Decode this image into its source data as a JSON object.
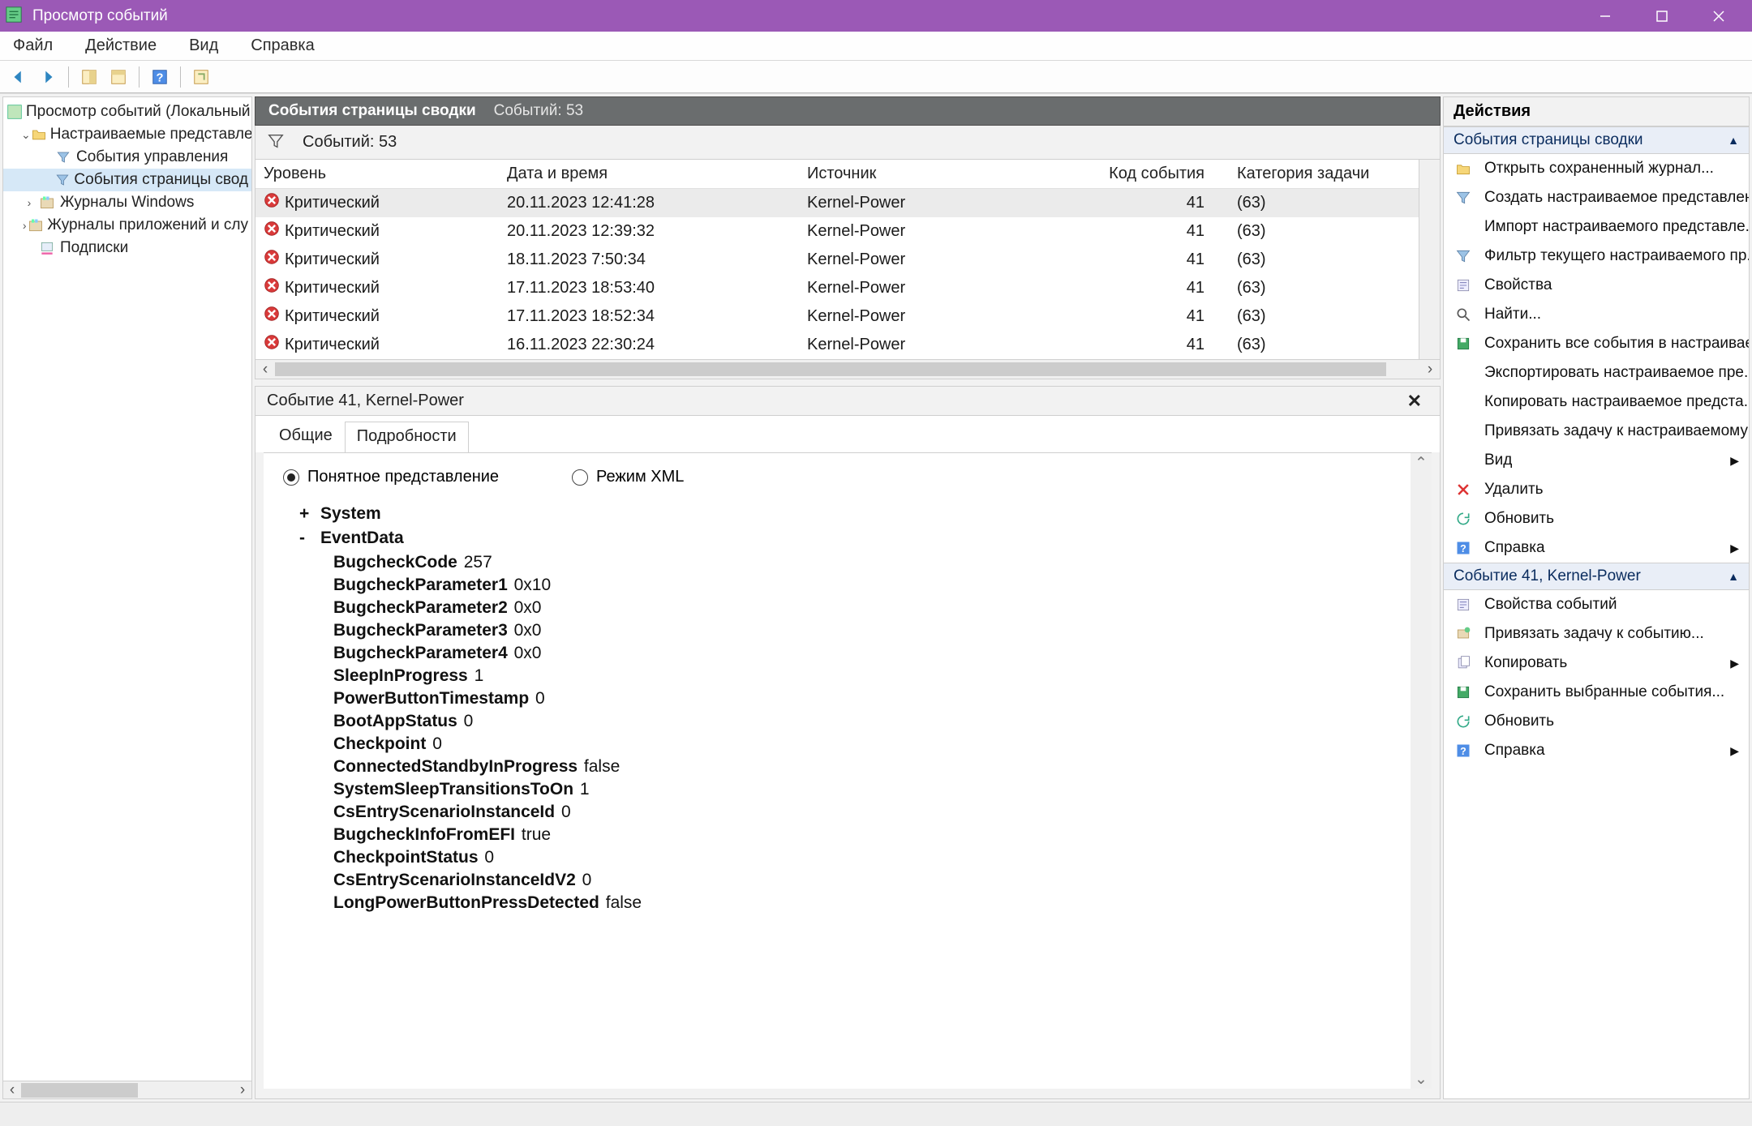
{
  "titlebar": {
    "title": "Просмотр событий"
  },
  "menubar": {
    "items": [
      "Файл",
      "Действие",
      "Вид",
      "Справка"
    ]
  },
  "tree": {
    "root": "Просмотр событий (Локальный",
    "custom_views": "Настраиваемые представлен",
    "admin_events": "События управления",
    "summary_events": "События страницы свод",
    "windows_logs": "Журналы Windows",
    "app_logs": "Журналы приложений и слу",
    "subscriptions": "Подписки"
  },
  "center": {
    "header_title": "События страницы сводки",
    "header_count": "Событий: 53",
    "filter_count": "Событий: 53",
    "columns": {
      "level": "Уровень",
      "datetime": "Дата и время",
      "source": "Источник",
      "code": "Код события",
      "category": "Категория задачи"
    },
    "rows": [
      {
        "level": "Критический",
        "datetime": "20.11.2023 12:41:28",
        "source": "Kernel-Power",
        "code": "41",
        "cat": "(63)"
      },
      {
        "level": "Критический",
        "datetime": "20.11.2023 12:39:32",
        "source": "Kernel-Power",
        "code": "41",
        "cat": "(63)"
      },
      {
        "level": "Критический",
        "datetime": "18.11.2023 7:50:34",
        "source": "Kernel-Power",
        "code": "41",
        "cat": "(63)"
      },
      {
        "level": "Критический",
        "datetime": "17.11.2023 18:53:40",
        "source": "Kernel-Power",
        "code": "41",
        "cat": "(63)"
      },
      {
        "level": "Критический",
        "datetime": "17.11.2023 18:52:34",
        "source": "Kernel-Power",
        "code": "41",
        "cat": "(63)"
      },
      {
        "level": "Критический",
        "datetime": "16.11.2023 22:30:24",
        "source": "Kernel-Power",
        "code": "41",
        "cat": "(63)"
      }
    ]
  },
  "detail": {
    "header": "Событие 41, Kernel-Power",
    "tabs": {
      "general": "Общие",
      "details": "Подробности"
    },
    "radios": {
      "friendly": "Понятное представление",
      "xml": "Режим XML"
    },
    "system_label": "System",
    "eventdata_label": "EventData",
    "eventdata": [
      {
        "k": "BugcheckCode",
        "v": "257"
      },
      {
        "k": "BugcheckParameter1",
        "v": "0x10"
      },
      {
        "k": "BugcheckParameter2",
        "v": "0x0"
      },
      {
        "k": "BugcheckParameter3",
        "v": "0x0"
      },
      {
        "k": "BugcheckParameter4",
        "v": "0x0"
      },
      {
        "k": "SleepInProgress",
        "v": "1"
      },
      {
        "k": "PowerButtonTimestamp",
        "v": "0"
      },
      {
        "k": "BootAppStatus",
        "v": "0"
      },
      {
        "k": "Checkpoint",
        "v": "0"
      },
      {
        "k": "ConnectedStandbyInProgress",
        "v": "false"
      },
      {
        "k": "SystemSleepTransitionsToOn",
        "v": "1"
      },
      {
        "k": "CsEntryScenarioInstanceId",
        "v": "0"
      },
      {
        "k": "BugcheckInfoFromEFI",
        "v": "true"
      },
      {
        "k": "CheckpointStatus",
        "v": "0"
      },
      {
        "k": "CsEntryScenarioInstanceIdV2",
        "v": "0"
      },
      {
        "k": "LongPowerButtonPressDetected",
        "v": "false"
      }
    ]
  },
  "actions": {
    "title": "Действия",
    "section1": "События страницы сводки",
    "items1": [
      "Открыть сохраненный журнал...",
      "Создать настраиваемое представлен...",
      "Импорт настраиваемого представле...",
      "Фильтр текущего настраиваемого пр...",
      "Свойства",
      "Найти...",
      "Сохранить все события в настраивае...",
      "Экспортировать настраиваемое пре...",
      "Копировать настраиваемое предста...",
      "Привязать задачу к настраиваемому ...",
      "Вид",
      "Удалить",
      "Обновить",
      "Справка"
    ],
    "section2": "Событие 41, Kernel-Power",
    "items2": [
      "Свойства событий",
      "Привязать задачу к событию...",
      "Копировать",
      "Сохранить выбранные события...",
      "Обновить",
      "Справка"
    ]
  }
}
